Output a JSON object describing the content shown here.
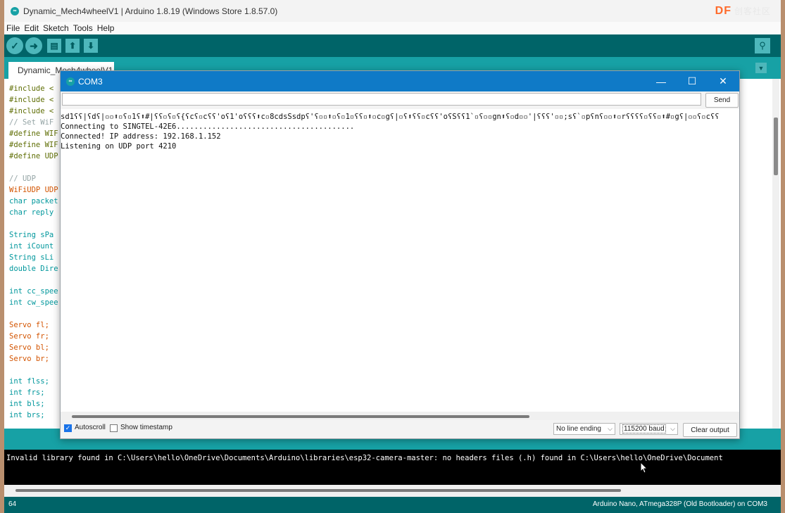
{
  "window": {
    "title": "Dynamic_Mech4wheelV1 | Arduino 1.8.19 (Windows Store 1.8.57.0)",
    "watermark_brand": "DF",
    "watermark_sub": "创客社区"
  },
  "menu": [
    "File",
    "Edit",
    "Sketch",
    "Tools",
    "Help"
  ],
  "tab": {
    "label": "Dynamic_Mech4wheelV1"
  },
  "code_lines": [
    "#include <",
    "#include <",
    "#include <",
    "// Set WiF",
    "#define WIF",
    "#define WIF",
    "#define UDP",
    "",
    "// UDP",
    "WiFiUDP UDP",
    "char packet",
    "char reply",
    "",
    "String sPa",
    "int iCount",
    "String sLi",
    "double Dire",
    "",
    "int cc_spee",
    "int cw_spee",
    "",
    "Servo fl;",
    "Servo fr;",
    "Servo bl;",
    "Servo br;",
    "",
    "int flss;",
    "int frs;",
    "int bls;",
    "int brs;"
  ],
  "serial_monitor": {
    "title": "COM3",
    "input_value": "",
    "send_label": "Send",
    "output_lines": [
      "sd1ʕʕ|ʕdʕ|▫▫⬆▫ʕ▫1ʕ⬆#|ʕʕ▫ʕ▫ʕ{ʕcʕ▫cʕʕ'oʕ1'oʕʕʕ⬆c▫8cdsSsdpʕ'ʕ▫▫⬆▫ʕ▫1▫ʕʕ▫⬆▫c▫gʕ|▫ʕ⬆ʕʕ▫cʕʕ'oʕSʕʕ1`▫ʕ▫▫gn⬆ʕ▫d▫▫'|ʕʕʕ'▫▫;sʕ`▫pʕnʕ▫▫⬆▫rʕʕʕʕ▫ʕʕ▫⬆#▫gʕ|▫▫ʕ▫cʕʕ",
      "Connecting to SINGTEL-42E6........................................",
      "Connected! IP address: 192.168.1.152",
      "Listening on UDP port 4210"
    ],
    "autoscroll_label": "Autoscroll",
    "autoscroll_checked": true,
    "timestamp_label": "Show timestamp",
    "timestamp_checked": false,
    "line_ending": "No line ending",
    "baud": "115200 baud",
    "clear_label": "Clear output",
    "close_glyph": "✕",
    "maximize_glyph": "☐",
    "minimize_glyph": "—"
  },
  "console": {
    "message": "Invalid library found in C:\\Users\\hello\\OneDrive\\Documents\\Arduino\\libraries\\esp32-camera-master: no headers files (.h) found in C:\\Users\\hello\\OneDrive\\Document"
  },
  "status": {
    "line_number": "64",
    "board": "Arduino Nano, ATmega328P (Old Bootloader) on COM3"
  }
}
